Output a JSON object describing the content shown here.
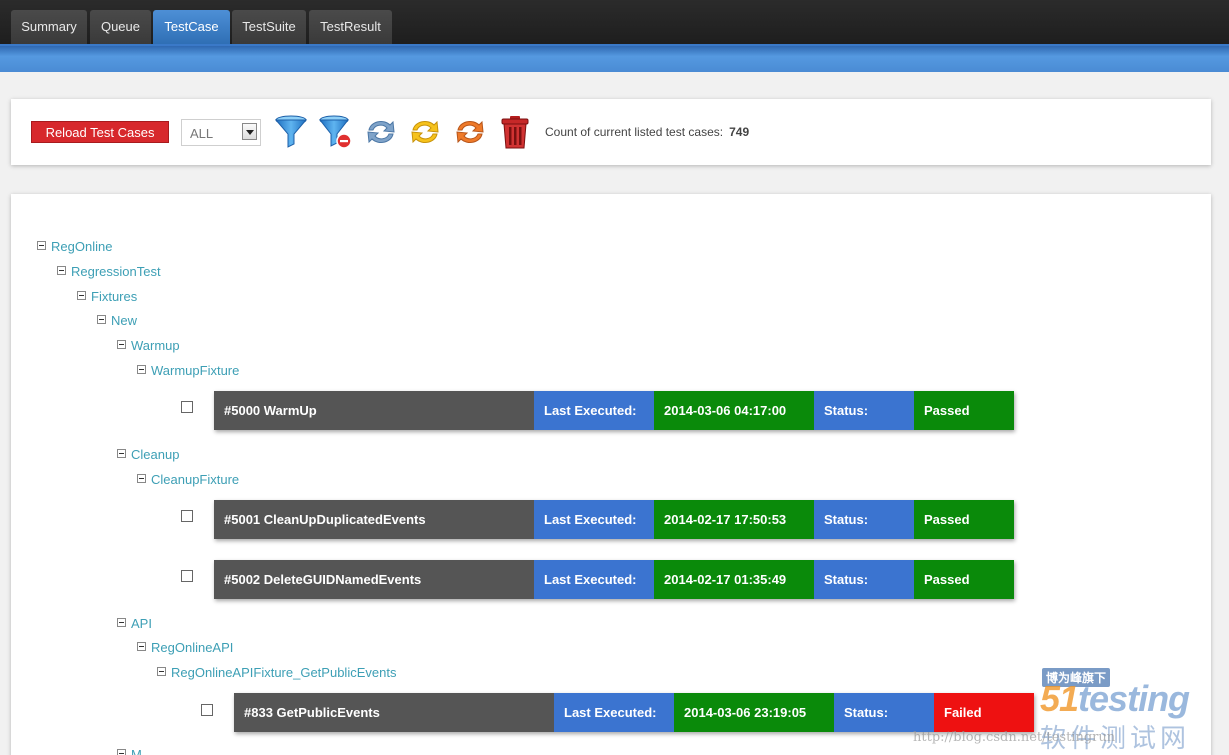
{
  "tabs": [
    {
      "label": "Summary"
    },
    {
      "label": "Queue"
    },
    {
      "label": "TestCase",
      "active": true
    },
    {
      "label": "TestSuite"
    },
    {
      "label": "TestResult"
    }
  ],
  "toolbar": {
    "reload_label": "Reload Test Cases",
    "filter_select_value": "ALL",
    "icons": [
      "filter-icon",
      "clear-filter-icon",
      "refresh-blue-icon",
      "refresh-yellow-icon",
      "refresh-orange-icon",
      "trash-icon"
    ],
    "count_label": "Count of current listed test cases:",
    "count_value": "749"
  },
  "tree": {
    "nodes": [
      {
        "label": "RegOnline"
      },
      {
        "label": "RegressionTest"
      },
      {
        "label": "Fixtures"
      },
      {
        "label": "New"
      },
      {
        "label": "Warmup"
      },
      {
        "label": "WarmupFixture"
      },
      {
        "label": "Cleanup"
      },
      {
        "label": "CleanupFixture"
      },
      {
        "label": "API"
      },
      {
        "label": "RegOnlineAPI"
      },
      {
        "label": "RegOnlineAPIFixture_GetPublicEvents"
      },
      {
        "label": "M"
      }
    ],
    "cases": [
      {
        "name": "#5000 WarmUp",
        "last_executed_label": "Last Executed:",
        "date": "2014-03-06 04:17:00",
        "status_label": "Status:",
        "status": "Passed"
      },
      {
        "name": "#5001 CleanUpDuplicatedEvents",
        "last_executed_label": "Last Executed:",
        "date": "2014-02-17 17:50:53",
        "status_label": "Status:",
        "status": "Passed"
      },
      {
        "name": "#5002 DeleteGUIDNamedEvents",
        "last_executed_label": "Last Executed:",
        "date": "2014-02-17 01:35:49",
        "status_label": "Status:",
        "status": "Passed"
      },
      {
        "name": "#833 GetPublicEvents",
        "last_executed_label": "Last Executed:",
        "date": "2014-03-06 23:19:05",
        "status_label": "Status:",
        "status": "Failed"
      }
    ]
  },
  "watermark": {
    "tag": "博为峰旗下",
    "logo_num": "51",
    "logo_text": "testing",
    "cn": "软件测试网",
    "url": "http://blog.csdn.net/testingrun"
  },
  "colors": {
    "passed": "#0a8a0a",
    "failed": "#ee1111",
    "label_blue": "#3b74d0",
    "name_gray": "#555555",
    "tree_link": "#3d9fb5",
    "reload_red": "#d7282c"
  }
}
